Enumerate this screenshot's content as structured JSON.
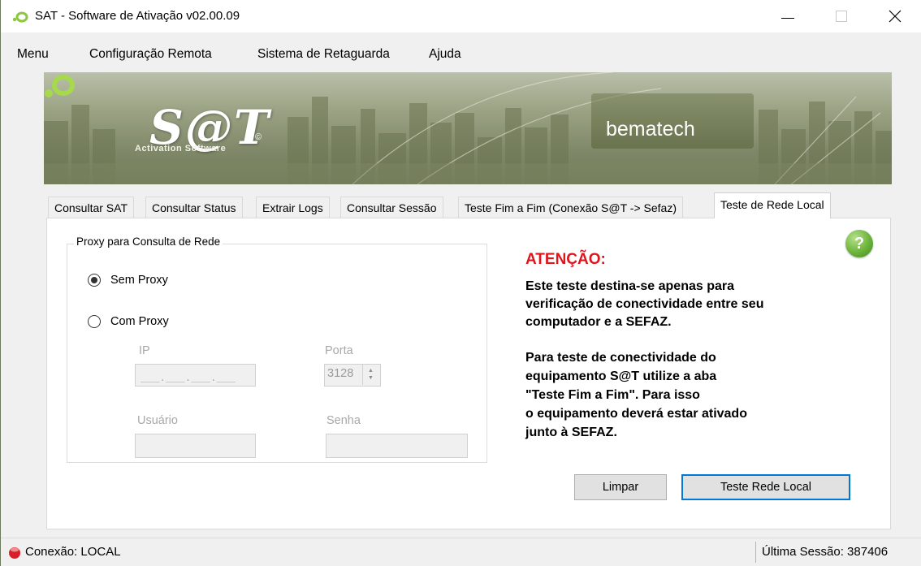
{
  "window": {
    "title": "SAT - Software de Ativação v02.00.09"
  },
  "menu": [
    "Menu",
    "Configuração Remota",
    "Sistema de Retaguarda",
    "Ajuda"
  ],
  "banner": {
    "logo": "S@T",
    "copyright": "©",
    "subtitle": "Activation Software",
    "brand": "bematech"
  },
  "tabs": [
    "Consultar SAT",
    "Consultar Status",
    "Extrair Logs",
    "Consultar Sessão",
    "Teste Fim a Fim (Conexão S@T -> Sefaz)",
    "Teste de Rede Local"
  ],
  "active_tab": "Teste de Rede Local",
  "help": {
    "label": "?"
  },
  "proxy": {
    "group_title": "Proxy para Consulta de Rede",
    "options": [
      {
        "label": "Sem Proxy",
        "selected": true
      },
      {
        "label": "Com Proxy",
        "selected": false
      }
    ],
    "ip_label": "IP",
    "ip_mask": "___.___.___.___",
    "porta_label": "Porta",
    "porta_value": "3128",
    "usuario_label": "Usuário",
    "senha_label": "Senha"
  },
  "attention": {
    "title": "ATENÇÃO:",
    "lines": [
      "Este teste destina-se apenas para",
      "verificação de conectividade entre seu",
      "computador e a SEFAZ.",
      "",
      "Para teste de conectividade do",
      "equipamento S@T utilize a aba",
      "\"Teste Fim a Fim\". Para isso",
      "o equipamento deverá estar ativado",
      "junto à SEFAZ."
    ]
  },
  "buttons": {
    "clear": "Limpar",
    "test": "Teste Rede Local"
  },
  "status": {
    "connection": "Conexão: LOCAL",
    "last_session": "Última Sessão: 387406",
    "connection_color": "#d9202a"
  }
}
